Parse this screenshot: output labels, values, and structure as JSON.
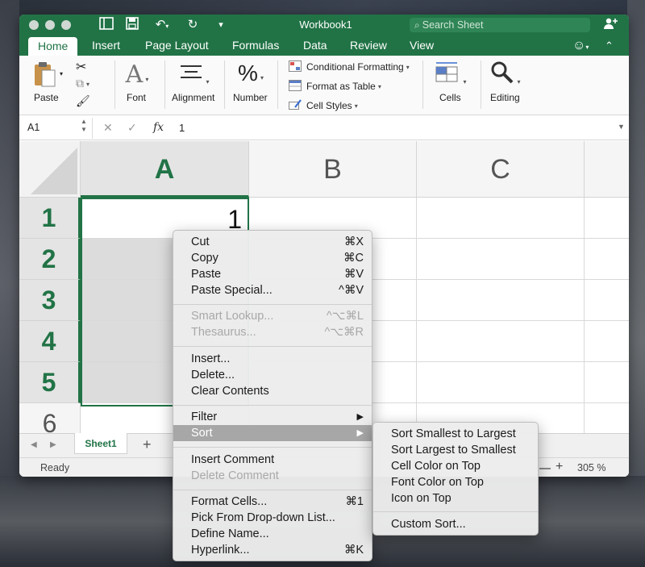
{
  "window": {
    "title": "Workbook1",
    "search_placeholder": "Search Sheet"
  },
  "ribbon_tabs": [
    "Home",
    "Insert",
    "Page Layout",
    "Formulas",
    "Data",
    "Review",
    "View"
  ],
  "ribbon": {
    "paste": "Paste",
    "font": "Font",
    "alignment": "Alignment",
    "number": "Number",
    "conditional_formatting": "Conditional Formatting",
    "format_as_table": "Format as Table",
    "cell_styles": "Cell Styles",
    "cells": "Cells",
    "editing": "Editing",
    "font_glyph": "A",
    "number_glyph": "%"
  },
  "formula_bar": {
    "name_box": "A1",
    "fx": "fx",
    "value": "1"
  },
  "grid": {
    "columns": [
      "A",
      "B",
      "C"
    ],
    "rows": [
      "1",
      "2",
      "3",
      "4",
      "5",
      "6"
    ],
    "a1_value": "1"
  },
  "sheet_tab": "Sheet1",
  "status": {
    "text": "Ready",
    "zoom": "305 %"
  },
  "context_menu": {
    "cut": "Cut",
    "cut_sc": "⌘X",
    "copy": "Copy",
    "copy_sc": "⌘C",
    "paste": "Paste",
    "paste_sc": "⌘V",
    "paste_special": "Paste Special...",
    "paste_special_sc": "^⌘V",
    "smart_lookup": "Smart Lookup...",
    "smart_lookup_sc": "^⌥⌘L",
    "thesaurus": "Thesaurus...",
    "thesaurus_sc": "^⌥⌘R",
    "insert": "Insert...",
    "delete": "Delete...",
    "clear_contents": "Clear Contents",
    "filter": "Filter",
    "sort": "Sort",
    "insert_comment": "Insert Comment",
    "delete_comment": "Delete Comment",
    "format_cells": "Format Cells...",
    "format_cells_sc": "⌘1",
    "pick_list": "Pick From Drop-down List...",
    "define_name": "Define Name...",
    "hyperlink": "Hyperlink...",
    "hyperlink_sc": "⌘K",
    "submenu_arrow": "▶"
  },
  "sort_menu": {
    "smallest_to_largest": "Sort Smallest to Largest",
    "largest_to_smallest": "Sort Largest to Smallest",
    "cell_color_on_top": "Cell Color on Top",
    "font_color_on_top": "Font Color on Top",
    "icon_on_top": "Icon on Top",
    "custom_sort": "Custom Sort..."
  },
  "colors": {
    "excel_green": "#217346"
  }
}
